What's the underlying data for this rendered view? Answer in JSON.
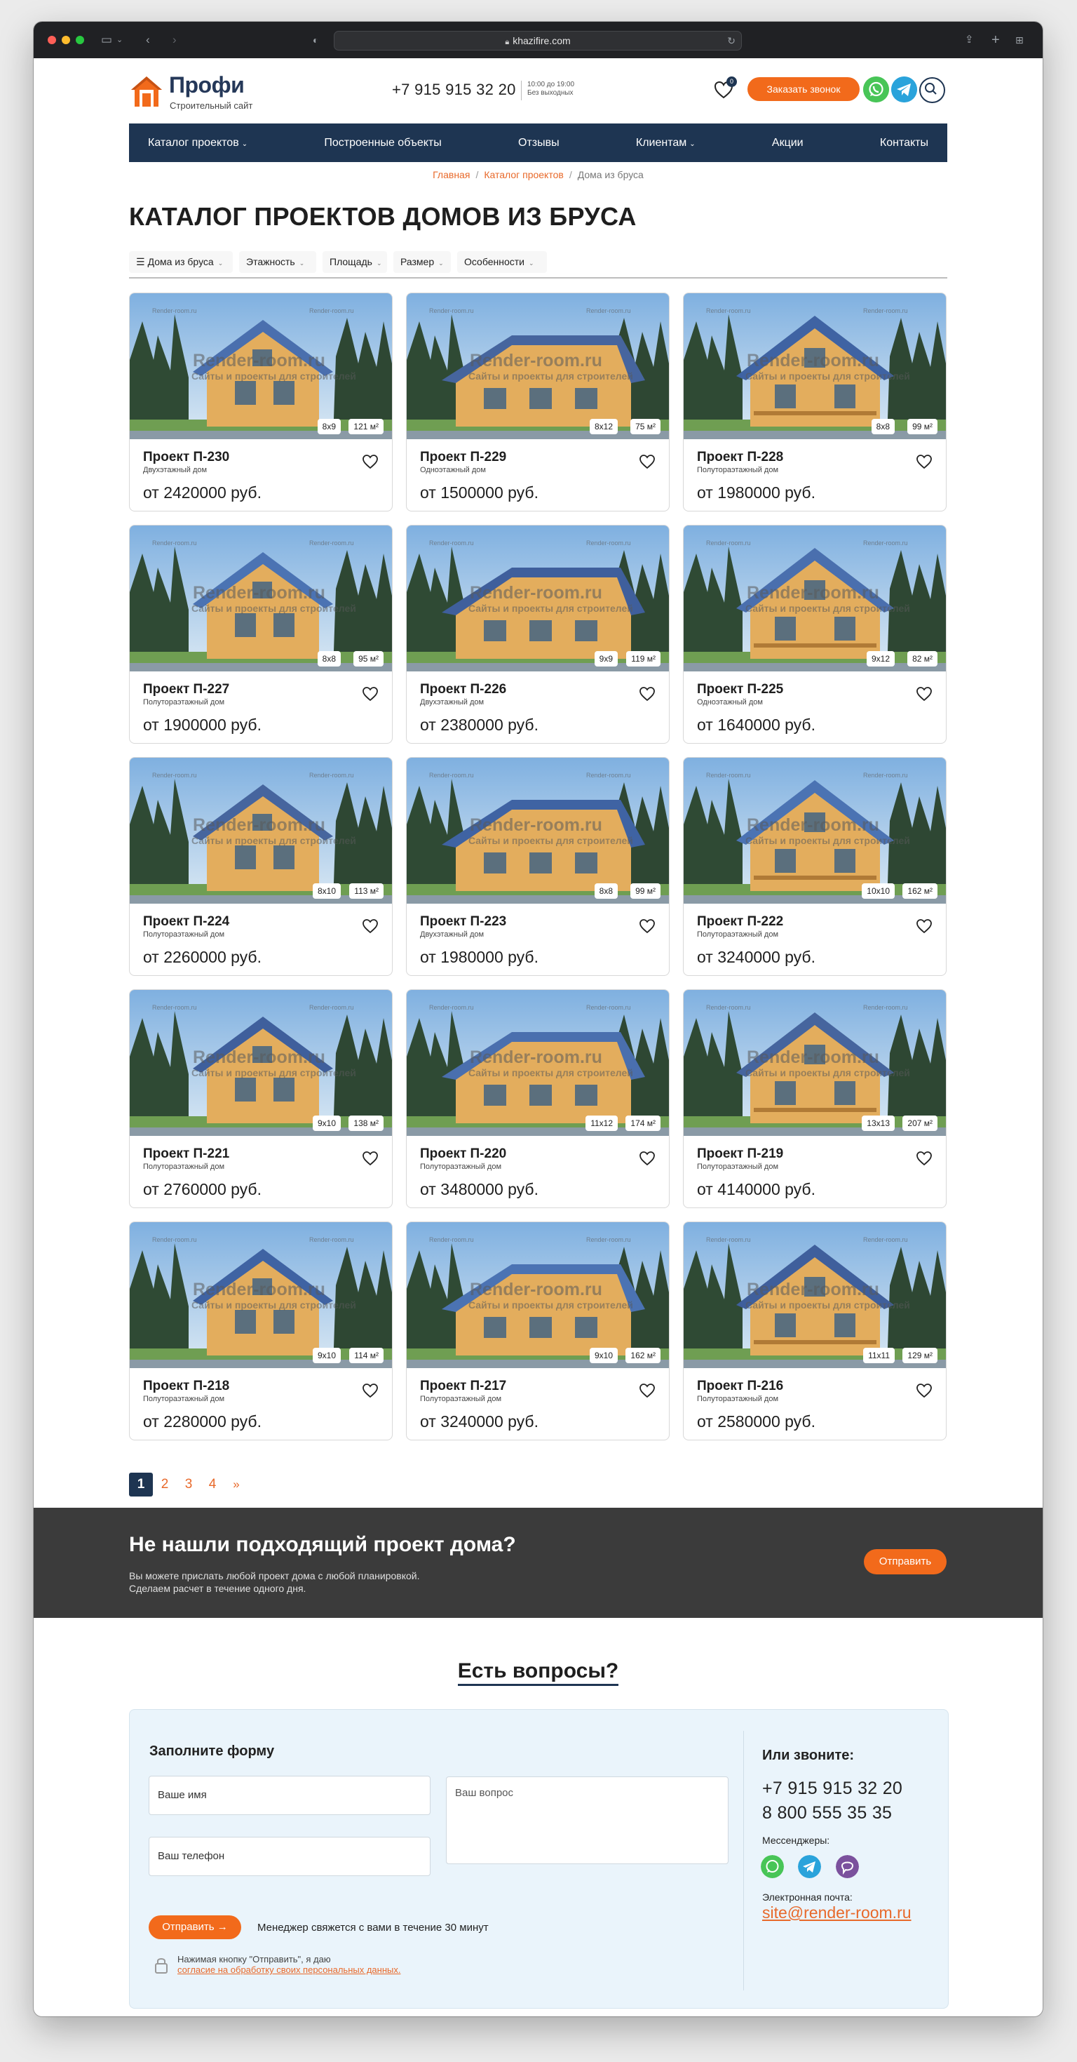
{
  "browser": {
    "url": "khazifire.com"
  },
  "header": {
    "logo_name": "Профи",
    "logo_sub": "Строительный сайт",
    "phone": "+7 915 915 32 20",
    "hours_line1": "10:00 до 19:00",
    "hours_line2": "Без выходных",
    "favorites_count": "0",
    "call_button": "Заказать звонок"
  },
  "nav": {
    "items": [
      {
        "label": "Каталог проектов",
        "caret": true
      },
      {
        "label": "Построенные объекты",
        "caret": false
      },
      {
        "label": "Отзывы",
        "caret": false
      },
      {
        "label": "Клиентам",
        "caret": true
      },
      {
        "label": "Акции",
        "caret": false
      },
      {
        "label": "Контакты",
        "caret": false
      }
    ]
  },
  "breadcrumb": {
    "home": "Главная",
    "catalog": "Каталог проектов",
    "current": "Дома из бруса"
  },
  "page_title": "КАТАЛОГ ПРОЕКТОВ ДОМОВ ИЗ БРУСА",
  "filters": [
    "Дома из бруса",
    "Этажность",
    "Площадь",
    "Размер",
    "Особенности"
  ],
  "watermark": {
    "main": "Render-room.ru",
    "sub": "Сайты и проекты для строителей",
    "small": "Render-room.ru"
  },
  "cards": [
    {
      "name": "Проект П-230",
      "type": "Двухэтажный дом",
      "price": "от 2420000 руб.",
      "size": "8x9",
      "area": "121 м²"
    },
    {
      "name": "Проект П-229",
      "type": "Одноэтажный дом",
      "price": "от 1500000 руб.",
      "size": "8x12",
      "area": "75 м²"
    },
    {
      "name": "Проект П-228",
      "type": "Полутораэтажный дом",
      "price": "от 1980000 руб.",
      "size": "8x8",
      "area": "99 м²"
    },
    {
      "name": "Проект П-227",
      "type": "Полутораэтажный дом",
      "price": "от 1900000 руб.",
      "size": "8x8",
      "area": "95 м²"
    },
    {
      "name": "Проект П-226",
      "type": "Двухэтажный дом",
      "price": "от 2380000 руб.",
      "size": "9x9",
      "area": "119 м²"
    },
    {
      "name": "Проект П-225",
      "type": "Одноэтажный дом",
      "price": "от 1640000 руб.",
      "size": "9x12",
      "area": "82 м²"
    },
    {
      "name": "Проект П-224",
      "type": "Полутораэтажный дом",
      "price": "от 2260000 руб.",
      "size": "8x10",
      "area": "113 м²"
    },
    {
      "name": "Проект П-223",
      "type": "Двухэтажный дом",
      "price": "от 1980000 руб.",
      "size": "8x8",
      "area": "99 м²"
    },
    {
      "name": "Проект П-222",
      "type": "Полутораэтажный дом",
      "price": "от 3240000 руб.",
      "size": "10x10",
      "area": "162 м²"
    },
    {
      "name": "Проект П-221",
      "type": "Полутораэтажный дом",
      "price": "от 2760000 руб.",
      "size": "9x10",
      "area": "138 м²"
    },
    {
      "name": "Проект П-220",
      "type": "Полутораэтажный дом",
      "price": "от 3480000 руб.",
      "size": "11x12",
      "area": "174 м²"
    },
    {
      "name": "Проект П-219",
      "type": "Полутораэтажный дом",
      "price": "от 4140000 руб.",
      "size": "13x13",
      "area": "207 м²"
    },
    {
      "name": "Проект П-218",
      "type": "Полутораэтажный дом",
      "price": "от 2280000 руб.",
      "size": "9x10",
      "area": "114 м²"
    },
    {
      "name": "Проект П-217",
      "type": "Полутораэтажный дом",
      "price": "от 3240000 руб.",
      "size": "9x10",
      "area": "162 м²"
    },
    {
      "name": "Проект П-216",
      "type": "Полутораэтажный дом",
      "price": "от 2580000 руб.",
      "size": "11x11",
      "area": "129 м²"
    }
  ],
  "pagination": {
    "pages": [
      "1",
      "2",
      "3",
      "4"
    ],
    "next": "»",
    "current": "1"
  },
  "cta": {
    "title": "Не нашли подходящий проект дома?",
    "text_line1": "Вы можете прислать любой проект дома с любой планировкой.",
    "text_line2": "Сделаем расчет в течение одного дня.",
    "button": "Отправить"
  },
  "questions": {
    "title": "Есть вопросы?",
    "form_head": "Заполните форму",
    "name_placeholder": "Ваше имя",
    "phone_placeholder": "Ваш телефон",
    "question_placeholder": "Ваш вопрос",
    "send_button": "Отправить →",
    "send_note": "Менеджер свяжется с вами в течение 30 минут",
    "consent_line1": "Нажимая кнопку \"Отправить\", я даю",
    "consent_link": "согласие на обработку своих персональных данных.",
    "call_head": "Или звоните:",
    "phone1": "+7 915 915 32 20",
    "phone2": "8 800 555 35 35",
    "messengers_label": "Мессенджеры:",
    "email_label": "Электронная почта:",
    "email": "site@render-room.ru"
  },
  "colors": {
    "accent_orange": "#f26a1b",
    "navy": "#1e3552",
    "dark_band": "#3b3b3b",
    "form_bg": "#eaf4fb"
  },
  "icons": [
    "sidebar-icon",
    "back-arrow-icon",
    "forward-arrow-icon",
    "shield-icon",
    "lock-icon",
    "reload-icon",
    "share-icon",
    "plus-icon",
    "tabs-icon",
    "heart-icon",
    "whatsapp-icon",
    "telegram-icon",
    "viber-icon",
    "search-icon",
    "menu-icon",
    "chevron-down-icon"
  ]
}
